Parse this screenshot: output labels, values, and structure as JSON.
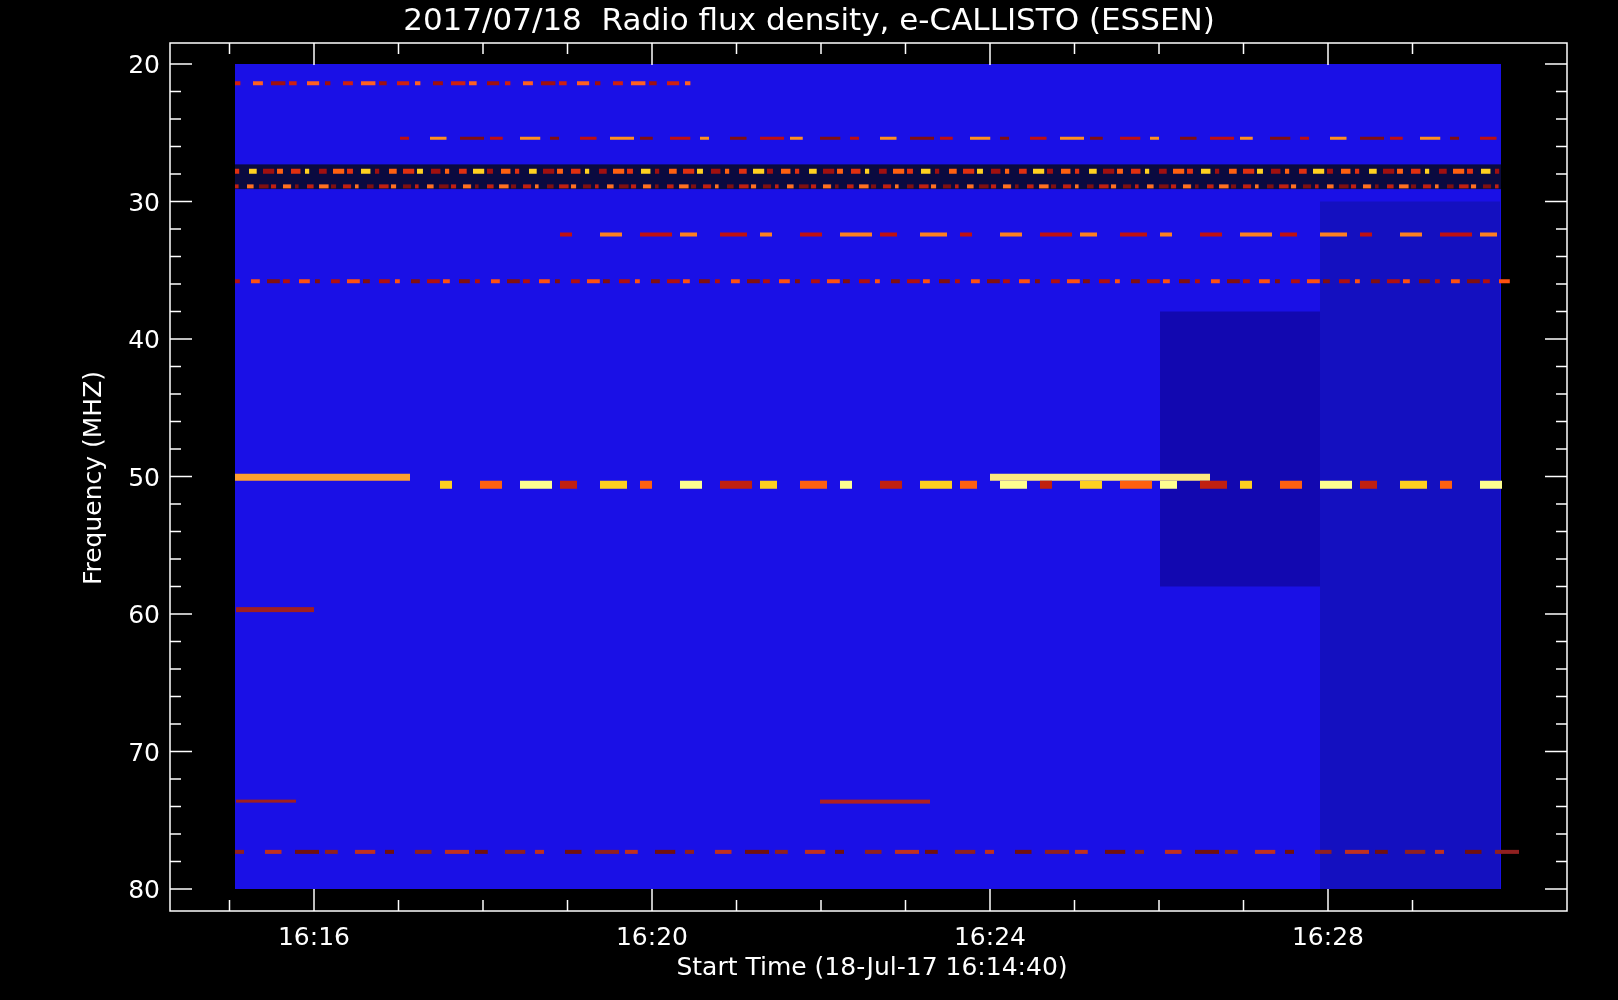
{
  "title": "2017/07/18  Radio flux density, e-CALLISTO (ESSEN)",
  "ylabel": "Frequency (MHZ)",
  "xlabel": "Start Time (18-Jul-17 16:14:40)",
  "yticks": [
    "20",
    "30",
    "40",
    "50",
    "60",
    "70",
    "80"
  ],
  "xticks": [
    "16:16",
    "16:20",
    "16:24",
    "16:28"
  ]
}
